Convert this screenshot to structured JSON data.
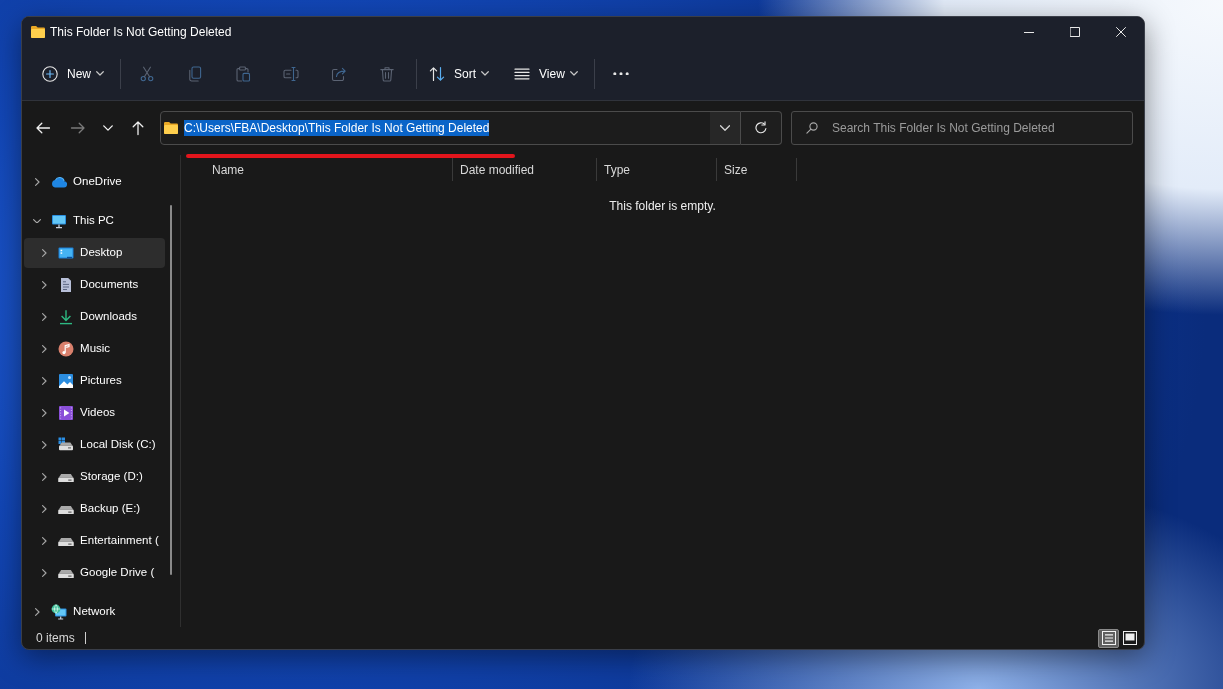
{
  "window": {
    "title": "This Folder Is Not Getting Deleted"
  },
  "toolbar": {
    "groups": [
      [
        {
          "kind": "new",
          "label": "New",
          "dropdown": true,
          "disabled": false
        }
      ],
      [
        {
          "kind": "cut",
          "disabled": true
        },
        {
          "kind": "copy",
          "disabled": true
        },
        {
          "kind": "paste",
          "disabled": true
        },
        {
          "kind": "rename",
          "disabled": true
        },
        {
          "kind": "share",
          "disabled": true
        },
        {
          "kind": "delete",
          "disabled": true
        }
      ],
      [
        {
          "kind": "sort",
          "label": "Sort",
          "dropdown": true,
          "disabled": false
        },
        {
          "kind": "view",
          "label": "View",
          "dropdown": true,
          "disabled": false
        }
      ],
      [
        {
          "kind": "more",
          "disabled": false
        }
      ]
    ]
  },
  "navigation": [
    {
      "kind": "back",
      "disabled": false
    },
    {
      "kind": "forward",
      "disabled": true
    },
    {
      "kind": "recent",
      "disabled": false
    },
    {
      "kind": "up",
      "disabled": false
    }
  ],
  "address_bar": {
    "path": "C:\\Users\\FBA\\Desktop\\This Folder Is Not Getting Deleted",
    "path_selected": true
  },
  "search": {
    "placeholder": "Search This Folder Is Not Getting Deleted"
  },
  "annotation": {
    "kind": "underline"
  },
  "sidebar": {
    "items": [
      {
        "kind": "cloud",
        "label": "OneDrive",
        "expanded": false,
        "selected": false
      },
      {
        "kind": "computer",
        "label": "This PC",
        "expanded": true,
        "selected": false,
        "children": [
          {
            "kind": "desktop",
            "label": "Desktop",
            "expanded": false,
            "selected": true
          },
          {
            "kind": "documents",
            "label": "Documents",
            "expanded": false,
            "selected": false
          },
          {
            "kind": "downloads",
            "label": "Downloads",
            "expanded": false,
            "selected": false
          },
          {
            "kind": "music",
            "label": "Music",
            "expanded": false,
            "selected": false
          },
          {
            "kind": "pictures",
            "label": "Pictures",
            "expanded": false,
            "selected": false
          },
          {
            "kind": "videos",
            "label": "Videos",
            "expanded": false,
            "selected": false
          },
          {
            "kind": "system-drive",
            "label": "Local Disk (C:)",
            "expanded": false,
            "selected": false
          },
          {
            "kind": "drive",
            "label": "Storage (D:)",
            "expanded": false,
            "selected": false
          },
          {
            "kind": "drive",
            "label": "Backup (E:)",
            "expanded": false,
            "selected": false
          },
          {
            "kind": "drive",
            "label": "Entertainment (",
            "expanded": false,
            "selected": false
          },
          {
            "kind": "drive",
            "label": "Google Drive (",
            "expanded": false,
            "selected": false
          }
        ]
      },
      {
        "kind": "network",
        "label": "Network",
        "expanded": false,
        "selected": false
      }
    ]
  },
  "file_list": {
    "columns": [
      "Name",
      "Date modified",
      "Type",
      "Size"
    ],
    "empty_message": "This folder is empty."
  },
  "status_bar": {
    "item_count": "0 items",
    "views": [
      {
        "kind": "details",
        "selected": true
      },
      {
        "kind": "tiles",
        "selected": false
      }
    ]
  }
}
